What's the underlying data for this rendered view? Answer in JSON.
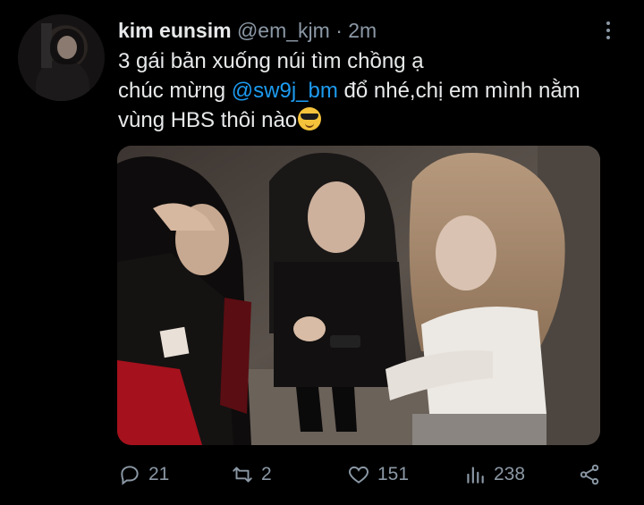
{
  "tweet": {
    "author_name": "kim eunsim",
    "author_handle": "@em_kjm",
    "separator": "·",
    "time_ago": "2m",
    "text_line1": "3 gái bản xuống núi tìm chồng ạ",
    "text_line2_prefix": "chúc mừng ",
    "mention": "@sw9j_bm",
    "text_line2_suffix": " đổ nhé,chị em mình nằm",
    "text_line3": "vùng HBS thôi nào",
    "emoji_icon": "sunglasses-smiling-face-icon"
  },
  "media": {
    "icon": "photo-three-women-night"
  },
  "actions": {
    "reply_count": "21",
    "retweet_count": "2",
    "like_count": "151",
    "views_count": "238",
    "reply_icon": "reply-icon",
    "retweet_icon": "retweet-icon",
    "like_icon": "heart-icon",
    "views_icon": "views-bar-chart-icon",
    "share_icon": "share-icon"
  },
  "colors": {
    "background": "#000000",
    "text": "#e7e9ea",
    "secondary": "#8b98a5",
    "mention": "#1d9bf0"
  }
}
